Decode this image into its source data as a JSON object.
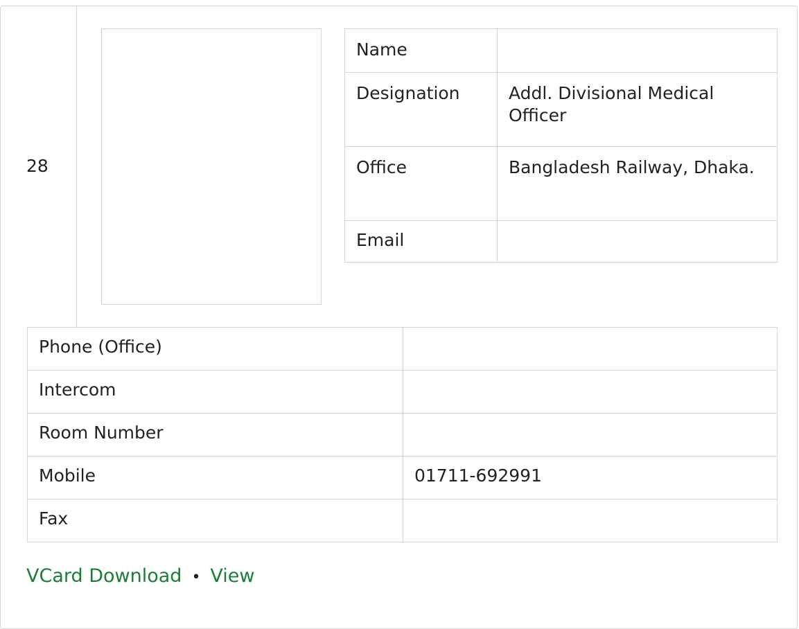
{
  "serial": "28",
  "info": {
    "name_label": "Name",
    "name_value": "",
    "designation_label": "Designation",
    "designation_value": "Addl. Divisional Medical Officer",
    "office_label": "Office",
    "office_value": "Bangladesh Railway, Dhaka.",
    "email_label": "Email",
    "email_value": ""
  },
  "contact": {
    "phone_label": "Phone (Office)",
    "phone_value": "",
    "intercom_label": "Intercom",
    "intercom_value": "",
    "room_label": "Room Number",
    "room_value": "",
    "mobile_label": "Mobile",
    "mobile_value": "01711-692991",
    "fax_label": "Fax",
    "fax_value": ""
  },
  "links": {
    "vcard": "VCard Download",
    "separator": "•",
    "view": "View"
  }
}
